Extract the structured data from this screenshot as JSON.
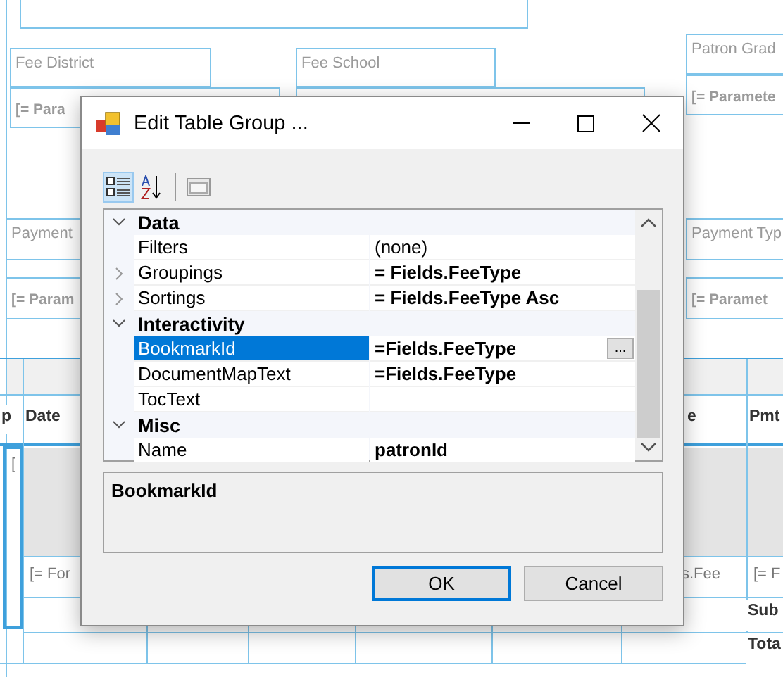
{
  "report_items": [
    {
      "kind": "label",
      "text": "Fee District"
    },
    {
      "kind": "param",
      "text": "[= Para"
    },
    {
      "kind": "label",
      "text": "Fee School"
    },
    {
      "kind": "label",
      "text": "Patron Grad"
    },
    {
      "kind": "param",
      "text": "[= Paramete"
    },
    {
      "kind": "label",
      "text": "Payment"
    },
    {
      "kind": "param",
      "text": "[= Param"
    },
    {
      "kind": "label",
      "text": "Payment Typ"
    },
    {
      "kind": "param",
      "text": "[= Paramet"
    },
    {
      "kind": "header",
      "text": "p"
    },
    {
      "kind": "header",
      "text": "Date"
    },
    {
      "kind": "header",
      "text": "e"
    },
    {
      "kind": "header",
      "text": "Pmt"
    },
    {
      "kind": "cell",
      "text": "["
    },
    {
      "kind": "cell",
      "text": "[= For"
    },
    {
      "kind": "cell",
      "text": "s.Fee"
    },
    {
      "kind": "cell",
      "text": "[= F"
    },
    {
      "kind": "header",
      "text": "Sub"
    },
    {
      "kind": "header",
      "text": "Tota"
    }
  ],
  "dialog": {
    "title": "Edit Table Group ...",
    "toolbar": [
      {
        "kind": "categorized",
        "selected": true
      },
      {
        "kind": "alphabetical",
        "selected": false
      },
      {
        "kind": "property-pages",
        "selected": false
      }
    ],
    "categories": [
      {
        "name": "Data",
        "expanded": true,
        "properties": [
          {
            "name": "Filters",
            "value": "(none)",
            "bold": false,
            "expandable": false,
            "selected": false
          },
          {
            "name": "Groupings",
            "value": "= Fields.FeeType",
            "bold": true,
            "expandable": true,
            "selected": false
          },
          {
            "name": "Sortings",
            "value": "= Fields.FeeType Asc",
            "bold": true,
            "expandable": true,
            "selected": false
          }
        ]
      },
      {
        "name": "Interactivity",
        "expanded": true,
        "properties": [
          {
            "name": "BookmarkId",
            "value": "=Fields.FeeType",
            "bold": true,
            "expandable": false,
            "selected": true,
            "button": "..."
          },
          {
            "name": "DocumentMapText",
            "value": "=Fields.FeeType",
            "bold": true,
            "expandable": false,
            "selected": false
          },
          {
            "name": "TocText",
            "expandable": false,
            "selected": false
          }
        ]
      },
      {
        "name": "Misc",
        "expanded": true,
        "properties": [
          {
            "name": "Name",
            "value": "patronId",
            "bold": true,
            "expandable": false,
            "selected": false
          }
        ]
      }
    ],
    "description": {
      "title": "BookmarkId"
    },
    "buttons": [
      {
        "label": "OK",
        "default": true
      },
      {
        "label": "Cancel",
        "default": false
      }
    ]
  }
}
